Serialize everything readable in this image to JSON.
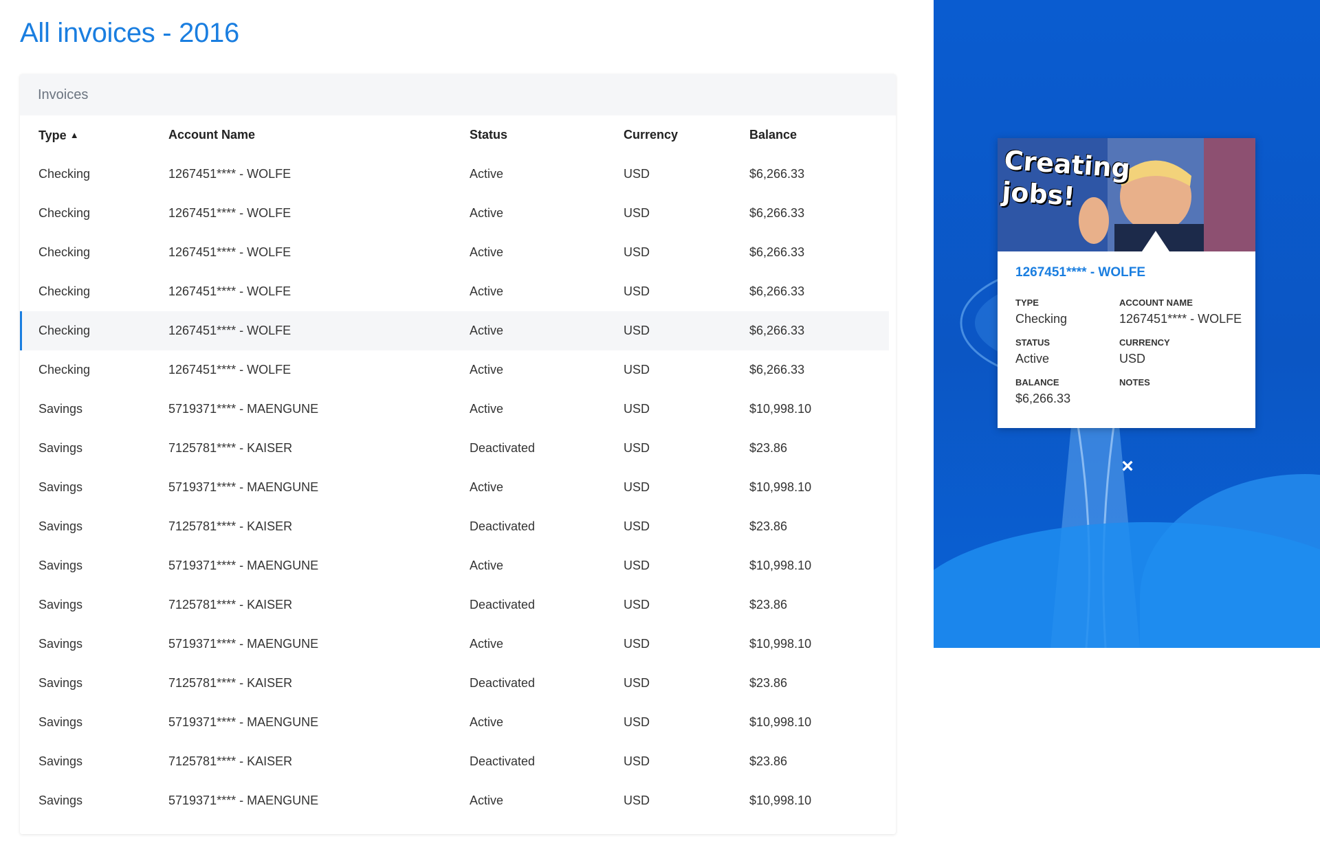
{
  "page": {
    "title": "All invoices - 2016"
  },
  "card": {
    "title": "Invoices"
  },
  "table": {
    "columns": [
      "Type",
      "Account Name",
      "Status",
      "Currency",
      "Balance"
    ],
    "sort_indicator": "▲",
    "rows": [
      [
        "Checking",
        "1267451**** - WOLFE",
        "Active",
        "USD",
        "$6,266.33"
      ],
      [
        "Checking",
        "1267451**** - WOLFE",
        "Active",
        "USD",
        "$6,266.33"
      ],
      [
        "Checking",
        "1267451**** - WOLFE",
        "Active",
        "USD",
        "$6,266.33"
      ],
      [
        "Checking",
        "1267451**** - WOLFE",
        "Active",
        "USD",
        "$6,266.33"
      ],
      [
        "Checking",
        "1267451**** - WOLFE",
        "Active",
        "USD",
        "$6,266.33"
      ],
      [
        "Checking",
        "1267451**** - WOLFE",
        "Active",
        "USD",
        "$6,266.33"
      ],
      [
        "Savings",
        "5719371**** - MAENGUNE",
        "Active",
        "USD",
        "$10,998.10"
      ],
      [
        "Savings",
        "7125781**** - KAISER",
        "Deactivated",
        "USD",
        "$23.86"
      ],
      [
        "Savings",
        "5719371**** - MAENGUNE",
        "Active",
        "USD",
        "$10,998.10"
      ],
      [
        "Savings",
        "7125781**** - KAISER",
        "Deactivated",
        "USD",
        "$23.86"
      ],
      [
        "Savings",
        "5719371**** - MAENGUNE",
        "Active",
        "USD",
        "$10,998.10"
      ],
      [
        "Savings",
        "7125781**** - KAISER",
        "Deactivated",
        "USD",
        "$23.86"
      ],
      [
        "Savings",
        "5719371**** - MAENGUNE",
        "Active",
        "USD",
        "$10,998.10"
      ],
      [
        "Savings",
        "7125781**** - KAISER",
        "Deactivated",
        "USD",
        "$23.86"
      ],
      [
        "Savings",
        "5719371**** - MAENGUNE",
        "Active",
        "USD",
        "$10,998.10"
      ],
      [
        "Savings",
        "7125781**** - KAISER",
        "Deactivated",
        "USD",
        "$23.86"
      ],
      [
        "Savings",
        "5719371**** - MAENGUNE",
        "Active",
        "USD",
        "$10,998.10"
      ]
    ],
    "selected_row": 4
  },
  "popup": {
    "image_caption": "Creating jobs!",
    "title": "1267451**** - WOLFE",
    "type_label": "TYPE",
    "type_value": "Checking",
    "account_label": "ACCOUNT NAME",
    "account_value": "1267451**** - WOLFE",
    "status_label": "STATUS",
    "status_value": "Active",
    "currency_label": "CURRENCY",
    "currency_value": "USD",
    "balance_label": "BALANCE",
    "balance_value": "$6,266.33",
    "notes_label": "NOTES",
    "close_icon": "×"
  },
  "colors": {
    "accent": "#1a7ee0",
    "panel_blue": "#0a5cd0"
  }
}
